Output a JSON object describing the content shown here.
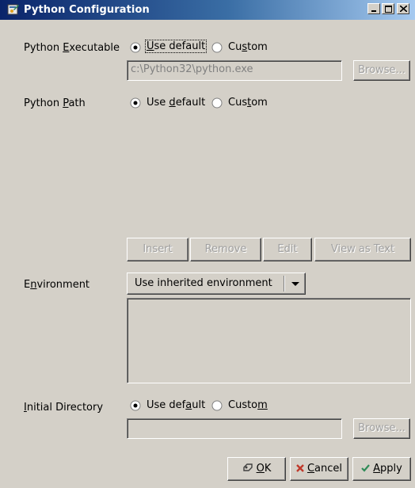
{
  "window": {
    "title": "Python Configuration",
    "icon": "python-config-icon"
  },
  "python_executable": {
    "label": "Python Executable",
    "mnemonic_label_prefix": "Python ",
    "mnemonic_char": "E",
    "mnemonic_suffix": "xecutable",
    "options": {
      "default_prefix": "",
      "default_u": "U",
      "default_rest": "se default",
      "custom_prefix": "Cu",
      "custom_u": "s",
      "custom_rest": "tom"
    },
    "selected": "Use default",
    "path_value": "c:\\Python32\\python.exe",
    "browse_label": "Browse..."
  },
  "python_path": {
    "label_prefix": "Python ",
    "label_u": "P",
    "label_rest": "ath",
    "options": {
      "default_prefix": "Use ",
      "default_u": "d",
      "default_rest": "efault",
      "custom_prefix": "Cus",
      "custom_u": "t",
      "custom_rest": "om"
    },
    "selected": "Use default",
    "buttons": {
      "insert": "Insert",
      "remove": "Remove",
      "edit": "Edit",
      "view_as_text": "View as Text"
    }
  },
  "environment": {
    "label_prefix": "E",
    "label_u": "n",
    "label_rest": "vironment",
    "selected": "Use inherited environment"
  },
  "initial_directory": {
    "label_prefix": "",
    "label_u": "I",
    "label_rest": "nitial Directory",
    "options": {
      "default_prefix": "Use def",
      "default_u": "a",
      "default_rest": "ult",
      "custom_prefix": "Custo",
      "custom_u": "m",
      "custom_rest": ""
    },
    "selected": "Use default",
    "path_value": "",
    "browse_label": "Browse..."
  },
  "footer": {
    "ok_u": "O",
    "ok_rest": "K",
    "cancel_u": "C",
    "cancel_rest": "ancel",
    "apply_u": "A",
    "apply_rest": "pply"
  },
  "colors": {
    "title_bar_start": "#0a246a",
    "title_bar_end": "#a6caf0",
    "face": "#d4d0c8",
    "cancel_icon": "#c0392b",
    "apply_icon": "#2e8b57"
  }
}
